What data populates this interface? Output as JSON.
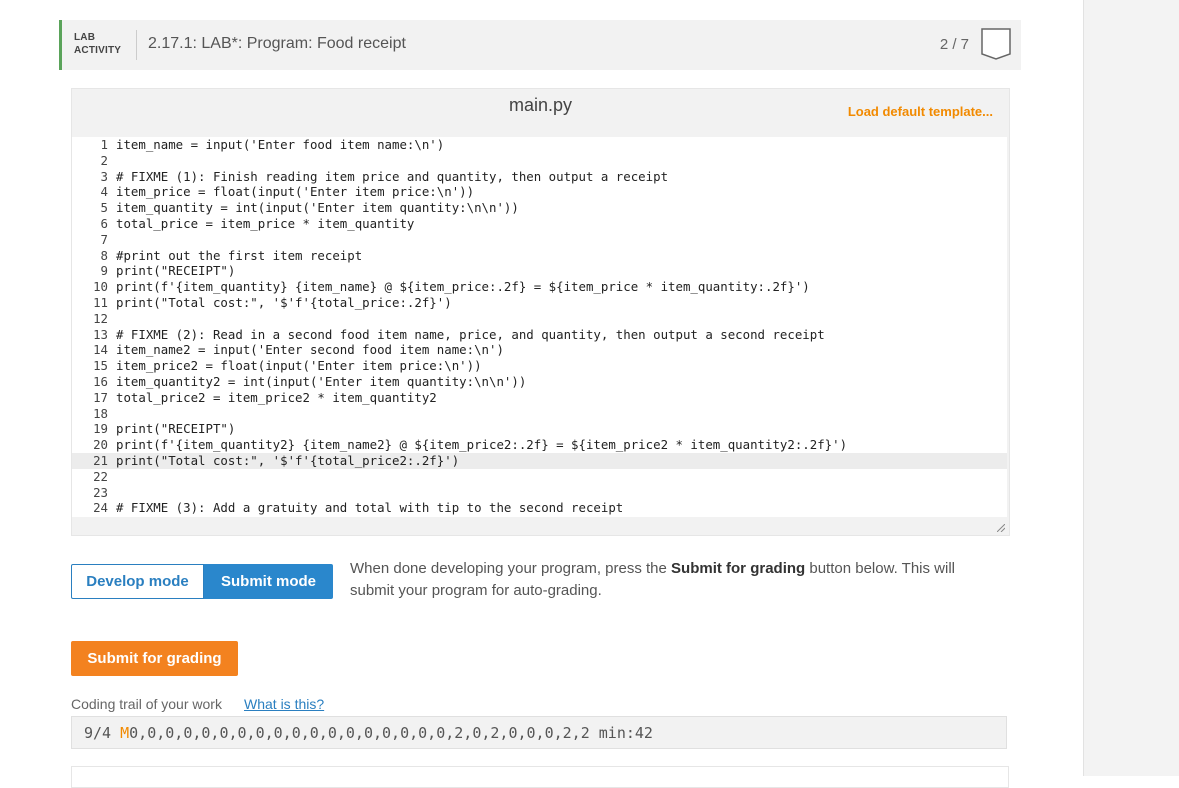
{
  "activity": {
    "type_line1": "LAB",
    "type_line2": "ACTIVITY",
    "title": "2.17.1: LAB*: Program: Food receipt",
    "progress": "2 / 7"
  },
  "editor": {
    "filename": "main.py",
    "load_default": "Load default template...",
    "lines": [
      "item_name = input('Enter food item name:\\n')",
      "",
      "# FIXME (1): Finish reading item price and quantity, then output a receipt",
      "item_price = float(input('Enter item price:\\n'))",
      "item_quantity = int(input('Enter item quantity:\\n\\n'))",
      "total_price = item_price * item_quantity",
      "",
      "#print out the first item receipt",
      "print(\"RECEIPT\")",
      "print(f'{item_quantity} {item_name} @ ${item_price:.2f} = ${item_price * item_quantity:.2f}')",
      "print(\"Total cost:\", '$'f'{total_price:.2f}')",
      "",
      "# FIXME (2): Read in a second food item name, price, and quantity, then output a second receipt",
      "item_name2 = input('Enter second food item name:\\n')",
      "item_price2 = float(input('Enter item price:\\n'))",
      "item_quantity2 = int(input('Enter item quantity:\\n\\n'))",
      "total_price2 = item_price2 * item_quantity2",
      "",
      "print(\"RECEIPT\")",
      "print(f'{item_quantity2} {item_name2} @ ${item_price2:.2f} = ${item_price2 * item_quantity2:.2f}')",
      "print(\"Total cost:\", '$'f'{total_price2:.2f}')",
      "",
      "",
      "# FIXME (3): Add a gratuity and total with tip to the second receipt"
    ],
    "active_line": 21
  },
  "modes": {
    "develop_label": "Develop mode",
    "submit_label": "Submit mode",
    "description_pre": "When done developing your program, press the ",
    "description_bold": "Submit for grading",
    "description_post": " button below. This will submit your program for auto-grading."
  },
  "submit_button": "Submit for grading",
  "coding_trail": {
    "label": "Coding trail of your work",
    "link": "What is this?",
    "date": "9/4 ",
    "first": "M",
    "values": "0,0,0,0,0,0,0,0,0,0,0,0,0,0,0,0,0,0,2,0,2,0,0,0,2,2 min:42"
  },
  "colors": {
    "accent_orange": "#f3821f",
    "accent_blue": "#2a87cc",
    "activity_green": "#5aa35a"
  }
}
